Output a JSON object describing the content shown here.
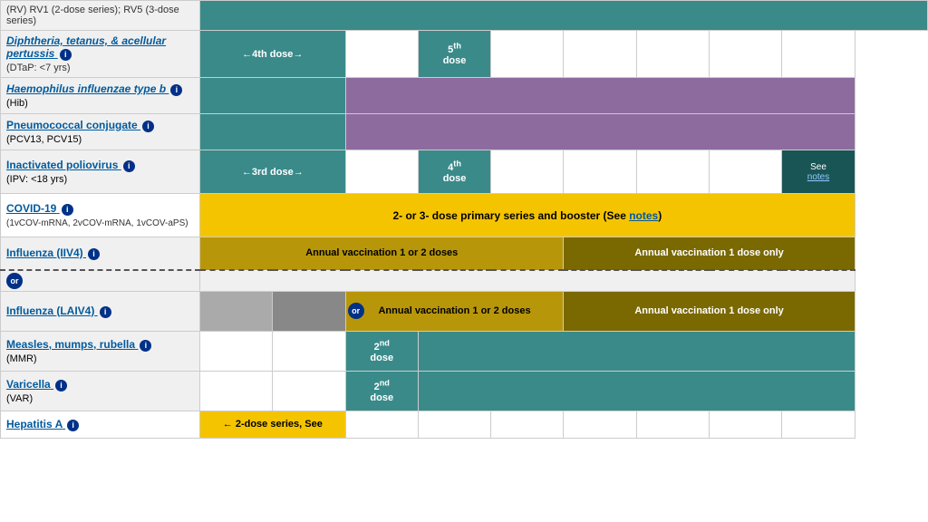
{
  "rows": [
    {
      "id": "rv",
      "name": "(RV) RV1 (2-dose series); RV5 (3-dose series)",
      "nameLink": false,
      "nameItalic": false,
      "sub": "",
      "cells": []
    },
    {
      "id": "dtap",
      "name": "Diphtheria, tetanus, & acellular pertussis",
      "nameLink": true,
      "nameItalic": false,
      "sub": "(DTaP: <7 yrs)",
      "hasInfo": true,
      "dose4text": "←4th dose→",
      "dose5text": "5th dose"
    },
    {
      "id": "hib",
      "name": "Haemophilus influenzae type b",
      "nameLink": true,
      "nameItalic": true,
      "sub": "(Hib)",
      "hasInfo": true
    },
    {
      "id": "pcv",
      "name": "Pneumococcal conjugate",
      "nameLink": true,
      "nameItalic": false,
      "sub": "(PCV13, PCV15)",
      "hasInfo": true
    },
    {
      "id": "ipv",
      "name": "Inactivated poliovirus",
      "nameLink": true,
      "nameItalic": false,
      "sub": "(IPV: <18 yrs)",
      "hasInfo": true,
      "dose3text": "←3rd dose→",
      "dose4text": "4th dose",
      "seeNotes": "See notes"
    },
    {
      "id": "covid",
      "name": "COVID-19",
      "nameLink": true,
      "nameItalic": false,
      "sub": "(1vCOV-mRNA, 2vCOV-mRNA, 1vCOV-aPS)",
      "hasInfo": true,
      "spanText": "2- or 3- dose primary series and booster (See notes)"
    },
    {
      "id": "influenza-iiv4",
      "name": "Influenza (IIV4)",
      "nameLink": true,
      "nameItalic": false,
      "sub": "",
      "hasInfo": true,
      "text1": "Annual vaccination 1 or 2 doses",
      "text2": "Annual vaccination 1 dose only"
    },
    {
      "id": "or-label",
      "special": "or"
    },
    {
      "id": "influenza-laiv4",
      "name": "Influenza (LAIV4)",
      "nameLink": true,
      "nameItalic": false,
      "sub": "",
      "hasInfo": true,
      "text1": "Annual vaccination 1 or 2 doses",
      "text2": "Annual vaccination 1 dose only"
    },
    {
      "id": "mmr",
      "name": "Measles, mumps, rubella",
      "nameLink": true,
      "nameItalic": false,
      "sub": "(MMR)",
      "hasInfo": true,
      "dose2text": "2nd dose"
    },
    {
      "id": "varicella",
      "name": "Varicella",
      "nameLink": true,
      "nameItalic": false,
      "sub": "(VAR)",
      "hasInfo": true,
      "dose2text": "2nd dose"
    },
    {
      "id": "hepa",
      "name": "Hepatitis A",
      "nameLink": true,
      "nameItalic": false,
      "sub": "",
      "hasInfo": true,
      "spanText": "← 2-dose series, See"
    }
  ],
  "colors": {
    "teal": "#3a8a8a",
    "tealDark": "#2a6666",
    "purple": "#8e6b9e",
    "yellow": "#f5c400",
    "yellowDark": "#b8960a",
    "grayGreen": "#607860",
    "darkTeal": "#1a5555",
    "darkSlate": "#2a5555"
  },
  "labels": {
    "infoIcon": "i",
    "orBadge": "or",
    "seeNotes": "notes"
  }
}
